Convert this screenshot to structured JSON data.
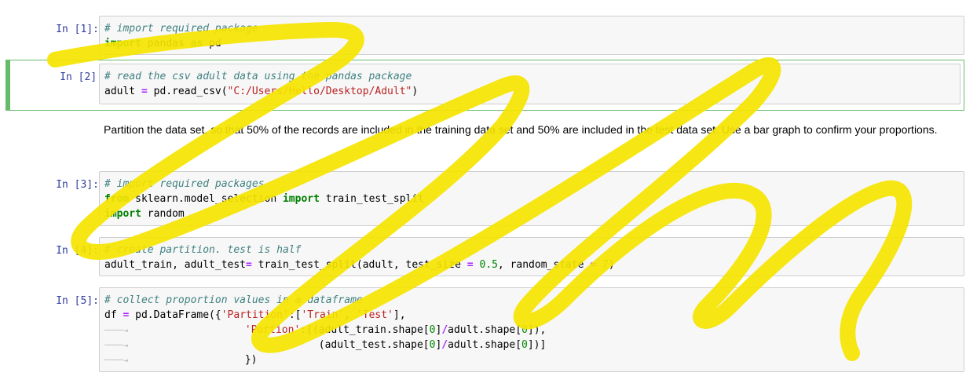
{
  "cells": [
    {
      "prompt": "In [1]:",
      "lines": [
        [
          [
            "cm-comment",
            "# import required package"
          ]
        ],
        [
          [
            "cm-keyword",
            "import"
          ],
          [
            "",
            " pandas "
          ],
          [
            "cm-keyword",
            "as"
          ],
          [
            "",
            " pd"
          ]
        ]
      ]
    },
    {
      "prompt": "In [2]:",
      "lines": [
        [
          [
            "cm-comment",
            "# read the csv adult data using the pandas package"
          ]
        ],
        [
          [
            "",
            "adult "
          ],
          [
            "cm-op",
            "="
          ],
          [
            "",
            " pd.read_csv("
          ],
          [
            "cm-string",
            "\"C:/Users/Hello/Desktop/Adult\""
          ],
          [
            "",
            ")"
          ]
        ]
      ]
    },
    {
      "prompt": "In [3]:",
      "lines": [
        [
          [
            "cm-comment",
            "# import required packages"
          ]
        ],
        [
          [
            "cm-keyword",
            "from"
          ],
          [
            "",
            " sklearn.model_selection "
          ],
          [
            "cm-keyword",
            "import"
          ],
          [
            "",
            " train_test_split"
          ]
        ],
        [
          [
            "cm-keyword",
            "import"
          ],
          [
            "",
            " random"
          ]
        ]
      ]
    },
    {
      "prompt": "In [4]:",
      "lines": [
        [
          [
            "cm-comment",
            "# create partition. test is half"
          ]
        ],
        [
          [
            "",
            "adult_train, adult_test"
          ],
          [
            "cm-op",
            "="
          ],
          [
            "",
            " train_test_split(adult, test_size "
          ],
          [
            "cm-op",
            "="
          ],
          [
            "",
            " "
          ],
          [
            "cm-number",
            "0.5"
          ],
          [
            "",
            ", random_state "
          ],
          [
            "cm-op",
            "="
          ],
          [
            "",
            " "
          ],
          [
            "cm-number",
            "7"
          ],
          [
            "",
            ")"
          ]
        ]
      ]
    },
    {
      "prompt": "In [5]:",
      "lines": [
        [
          [
            "cm-comment",
            "# collect proportion values in a dataframe"
          ]
        ],
        [
          [
            "",
            "df "
          ],
          [
            "cm-op",
            "="
          ],
          [
            "",
            " pd.DataFrame({"
          ],
          [
            "cm-string",
            "'Partition'"
          ],
          [
            "",
            ":["
          ],
          [
            "cm-string",
            "'Train'"
          ],
          [
            "",
            ", "
          ],
          [
            "cm-string",
            "'Test'"
          ],
          [
            "",
            "],"
          ]
        ],
        [
          [
            "tab-arrow",
            "────⇥"
          ],
          [
            "",
            "                   "
          ],
          [
            "cm-string",
            "'Portion'"
          ],
          [
            "",
            ":[(adult_train.shape["
          ],
          [
            "cm-number",
            "0"
          ],
          [
            "",
            "]"
          ],
          [
            "cm-op",
            "/"
          ],
          [
            "",
            "adult.shape["
          ],
          [
            "cm-number",
            "0"
          ],
          [
            "",
            "]),"
          ]
        ],
        [
          [
            "tab-arrow",
            "────⇥"
          ],
          [
            "",
            "                               (adult_test.shape["
          ],
          [
            "cm-number",
            "0"
          ],
          [
            "",
            "]"
          ],
          [
            "cm-op",
            "/"
          ],
          [
            "",
            "adult.shape["
          ],
          [
            "cm-number",
            "0"
          ],
          [
            "",
            "])]"
          ]
        ],
        [
          [
            "tab-arrow",
            "────⇥"
          ],
          [
            "",
            "                   })"
          ]
        ]
      ]
    }
  ],
  "markdown": {
    "text": "Partition the data set, so that 50% of the records are included in the training data set and 50% are included in the test data set. Use a bar graph to confirm your proportions."
  },
  "colors": {
    "prompt": "#303f9f",
    "selected_border": "#66bb6a",
    "scribble": "#f5e400"
  }
}
